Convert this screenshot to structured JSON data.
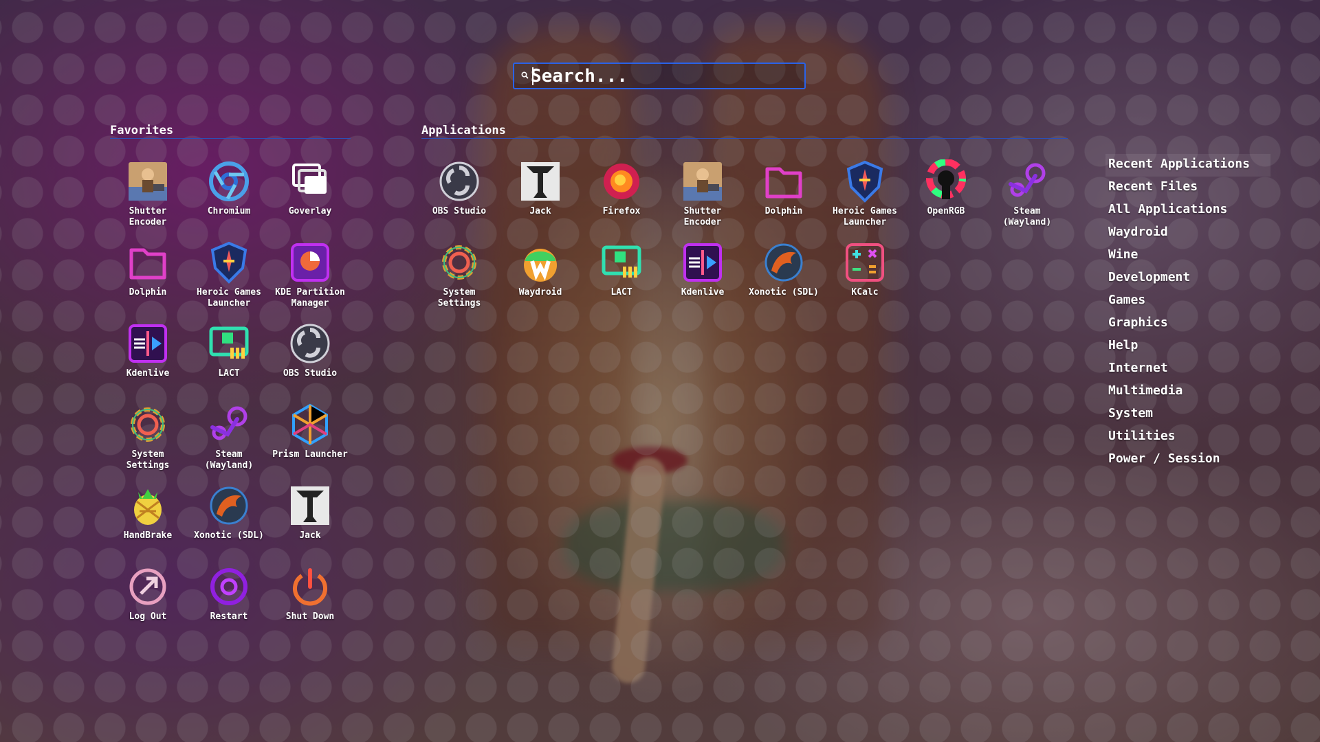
{
  "search": {
    "placeholder": "Search..."
  },
  "favorites": {
    "title": "Favorites",
    "items": [
      {
        "label": "Shutter\nEncoder",
        "icon": "shutter-encoder-icon"
      },
      {
        "label": "Chromium",
        "icon": "chromium-icon"
      },
      {
        "label": "Goverlay",
        "icon": "goverlay-icon"
      },
      {
        "label": "Dolphin",
        "icon": "dolphin-icon"
      },
      {
        "label": "Heroic Games\nLauncher",
        "icon": "heroic-icon"
      },
      {
        "label": "KDE Partition\nManager",
        "icon": "partition-manager-icon"
      },
      {
        "label": "Kdenlive",
        "icon": "kdenlive-icon"
      },
      {
        "label": "LACT",
        "icon": "lact-icon"
      },
      {
        "label": "OBS Studio",
        "icon": "obs-icon"
      },
      {
        "label": "System\nSettings",
        "icon": "settings-icon"
      },
      {
        "label": "Steam\n(Wayland)",
        "icon": "steam-icon"
      },
      {
        "label": "Prism Launcher",
        "icon": "prism-launcher-icon"
      },
      {
        "label": "HandBrake",
        "icon": "handbrake-icon"
      },
      {
        "label": "Xonotic (SDL)",
        "icon": "xonotic-icon"
      },
      {
        "label": "Jack",
        "icon": "jack-icon"
      },
      {
        "label": "Log Out",
        "icon": "logout-icon"
      },
      {
        "label": "Restart",
        "icon": "restart-icon"
      },
      {
        "label": "Shut Down",
        "icon": "shutdown-icon"
      }
    ]
  },
  "applications": {
    "title": "Applications",
    "items": [
      {
        "label": "OBS Studio",
        "icon": "obs-icon"
      },
      {
        "label": "Jack",
        "icon": "jack-icon"
      },
      {
        "label": "Firefox",
        "icon": "firefox-icon"
      },
      {
        "label": "Shutter\nEncoder",
        "icon": "shutter-encoder-icon"
      },
      {
        "label": "Dolphin",
        "icon": "dolphin-icon"
      },
      {
        "label": "Heroic Games\nLauncher",
        "icon": "heroic-icon"
      },
      {
        "label": "OpenRGB",
        "icon": "openrgb-icon"
      },
      {
        "label": "Steam\n(Wayland)",
        "icon": "steam-icon"
      },
      {
        "label": "System\nSettings",
        "icon": "settings-icon"
      },
      {
        "label": "Waydroid",
        "icon": "waydroid-icon"
      },
      {
        "label": "LACT",
        "icon": "lact-icon"
      },
      {
        "label": "Kdenlive",
        "icon": "kdenlive-icon"
      },
      {
        "label": "Xonotic (SDL)",
        "icon": "xonotic-icon"
      },
      {
        "label": "KCalc",
        "icon": "kcalc-icon"
      }
    ]
  },
  "categories": {
    "active_index": 0,
    "items": [
      "Recent Applications",
      "Recent Files",
      "All Applications",
      "Waydroid",
      "Wine",
      "Development",
      "Games",
      "Graphics",
      "Help",
      "Internet",
      "Multimedia",
      "System",
      "Utilities",
      "Power / Session"
    ]
  },
  "colors": {
    "accent": "#2962e8",
    "divider": "#2b4fb8"
  }
}
